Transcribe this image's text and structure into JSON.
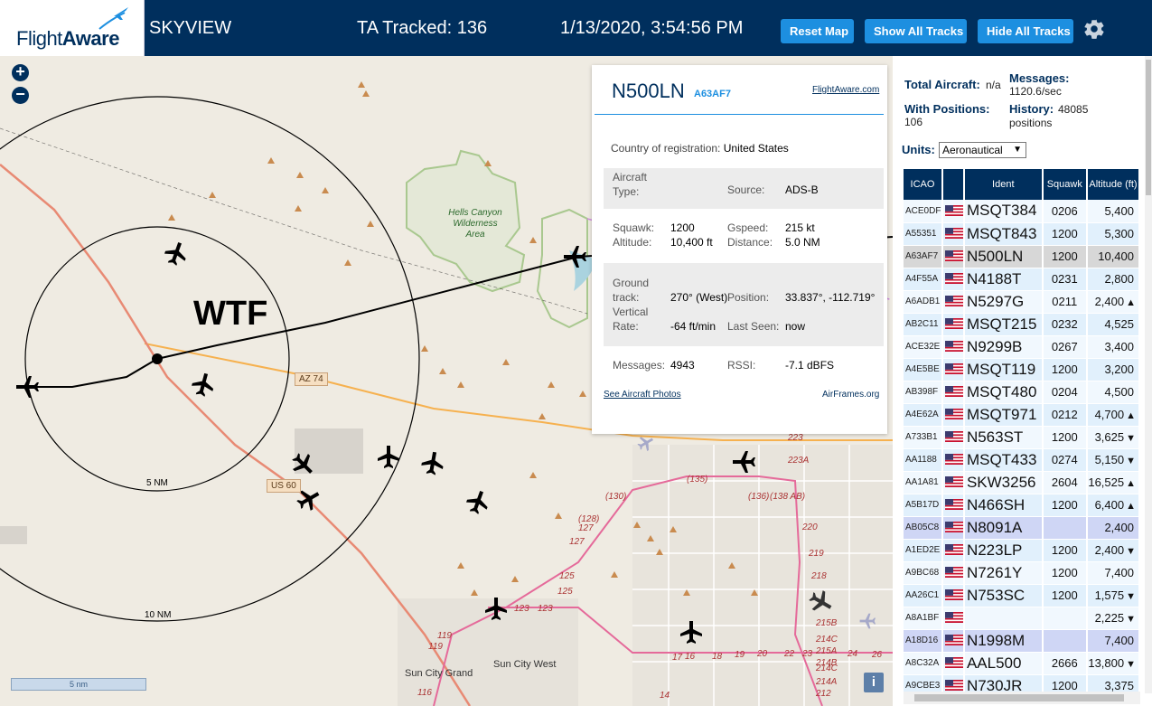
{
  "header": {
    "logo_flight": "Flight",
    "logo_aware": "Aware",
    "site_name": "SKYVIEW",
    "tracked": "TA Tracked: 136",
    "clock": "1/13/2020, 3:54:56 PM",
    "buttons": {
      "reset": "Reset Map",
      "show_all": "Show All Tracks",
      "hide_all": "Hide All Tracks"
    },
    "settings_icon": "gear-icon"
  },
  "map": {
    "zoom_in": "+",
    "zoom_out": "−",
    "site_label": "WTF",
    "ring_labels": {
      "inner": "5 NM",
      "outer": "10 NM"
    },
    "road_shields": {
      "az74": "AZ 74",
      "us60": "US 60"
    },
    "wilderness": "Hells Canyon Wilderness Area",
    "towns": {
      "sun_city_grand": "Sun City Grand",
      "sun_city_west": "Sun City West"
    },
    "scale": "5 nm",
    "info_icon": "i",
    "route_numbers": [
      "223",
      "223A",
      "220",
      "219",
      "218",
      "215B",
      "214C",
      "215A",
      "214B",
      "214C",
      "214A",
      "212",
      "(130)",
      "(135)",
      "(136)",
      "(138 AB)",
      "(128)",
      "127",
      "127",
      "125",
      "125",
      "123",
      "123",
      "119",
      "119",
      "116",
      "14",
      "16",
      "17",
      "18",
      "19",
      "20",
      "22",
      "23",
      "24",
      "26"
    ]
  },
  "info_panel": {
    "callsign": "N500LN",
    "hex": "A63AF7",
    "flightaware_link": "FlightAware.com",
    "country_label": "Country of registration:",
    "country": "United States",
    "aircraft_type_label": "Aircraft Type:",
    "aircraft_type": "",
    "source_label": "Source:",
    "source": "ADS-B",
    "squawk_label": "Squawk:",
    "squawk": "1200",
    "altitude_label": "Altitude:",
    "altitude": "10,400 ft",
    "gspeed_label": "Gspeed:",
    "gspeed": "215 kt",
    "distance_label": "Distance:",
    "distance": "5.0 NM",
    "ground_track_label": "Ground track:",
    "ground_track": "270° (West)",
    "position_label": "Position:",
    "position": "33.837°, -112.719°",
    "vert_rate_label": "Vertical Rate:",
    "vert_rate": "-64 ft/min",
    "last_seen_label": "Last Seen:",
    "last_seen": "now",
    "messages_label": "Messages:",
    "messages": "4943",
    "rssi_label": "RSSI:",
    "rssi": "-7.1 dBFS",
    "photos_link": "See Aircraft Photos",
    "airframes_link": "AirFrames.org"
  },
  "sidebar": {
    "total_aircraft_label": "Total Aircraft:",
    "total_aircraft": "n/a",
    "with_positions_label": "With Positions:",
    "with_positions": "106",
    "messages_label": "Messages:",
    "messages": "1120.6/sec",
    "history_label": "History:",
    "history": "48085 positions",
    "units_label": "Units:",
    "units_value": "Aeronautical",
    "table": {
      "headers": {
        "icao": "ICAO",
        "ident": "Ident",
        "squawk": "Squawk",
        "altitude": "Altitude (ft)"
      },
      "rows": [
        {
          "icao": "ACE0DF",
          "ident": "MSQT384",
          "squawk": "0206",
          "alt": "5,400",
          "trend": "",
          "style": "odd"
        },
        {
          "icao": "A55351",
          "ident": "MSQT843",
          "squawk": "1200",
          "alt": "5,300",
          "trend": "",
          "style": "even"
        },
        {
          "icao": "A63AF7",
          "ident": "N500LN",
          "squawk": "1200",
          "alt": "10,400",
          "trend": "",
          "style": "sel"
        },
        {
          "icao": "A4F55A",
          "ident": "N4188T",
          "squawk": "0231",
          "alt": "2,800",
          "trend": "",
          "style": "even"
        },
        {
          "icao": "A6ADB1",
          "ident": "N5297G",
          "squawk": "0211",
          "alt": "2,400",
          "trend": "▲",
          "style": "odd"
        },
        {
          "icao": "AB2C11",
          "ident": "MSQT215",
          "squawk": "0232",
          "alt": "4,525",
          "trend": "",
          "style": "even"
        },
        {
          "icao": "ACE32E",
          "ident": "N9299B",
          "squawk": "0267",
          "alt": "3,400",
          "trend": "",
          "style": "odd"
        },
        {
          "icao": "A4E5BE",
          "ident": "MSQT119",
          "squawk": "1200",
          "alt": "3,200",
          "trend": "",
          "style": "even"
        },
        {
          "icao": "AB398F",
          "ident": "MSQT480",
          "squawk": "0204",
          "alt": "4,500",
          "trend": "",
          "style": "odd"
        },
        {
          "icao": "A4E62A",
          "ident": "MSQT971",
          "squawk": "0212",
          "alt": "4,700",
          "trend": "▲",
          "style": "even"
        },
        {
          "icao": "A733B1",
          "ident": "N563ST",
          "squawk": "1200",
          "alt": "3,625",
          "trend": "▼",
          "style": "odd"
        },
        {
          "icao": "AA1188",
          "ident": "MSQT433",
          "squawk": "0274",
          "alt": "5,150",
          "trend": "▼",
          "style": "even"
        },
        {
          "icao": "AA1A81",
          "ident": "SKW3256",
          "squawk": "2604",
          "alt": "16,525",
          "trend": "▲",
          "style": "odd"
        },
        {
          "icao": "A5B17D",
          "ident": "N466SH",
          "squawk": "1200",
          "alt": "6,400",
          "trend": "▲",
          "style": "even"
        },
        {
          "icao": "AB05C8",
          "ident": "N8091A",
          "squawk": "",
          "alt": "2,400",
          "trend": "",
          "style": "hl"
        },
        {
          "icao": "A1ED2E",
          "ident": "N223LP",
          "squawk": "1200",
          "alt": "2,400",
          "trend": "▼",
          "style": "even"
        },
        {
          "icao": "A9BC68",
          "ident": "N7261Y",
          "squawk": "1200",
          "alt": "7,400",
          "trend": "",
          "style": "odd"
        },
        {
          "icao": "AA26C1",
          "ident": "N753SC",
          "squawk": "1200",
          "alt": "1,575",
          "trend": "▼",
          "style": "even"
        },
        {
          "icao": "A8A1BF",
          "ident": "",
          "squawk": "",
          "alt": "2,225",
          "trend": "▼",
          "style": "odd"
        },
        {
          "icao": "A18D16",
          "ident": "N1998M",
          "squawk": "",
          "alt": "7,400",
          "trend": "",
          "style": "hl"
        },
        {
          "icao": "A8C32A",
          "ident": "AAL500",
          "squawk": "2666",
          "alt": "13,800",
          "trend": "▼",
          "style": "odd"
        },
        {
          "icao": "A9CBE3",
          "ident": "N730JR",
          "squawk": "1200",
          "alt": "3,375",
          "trend": "",
          "style": "even"
        }
      ]
    }
  }
}
